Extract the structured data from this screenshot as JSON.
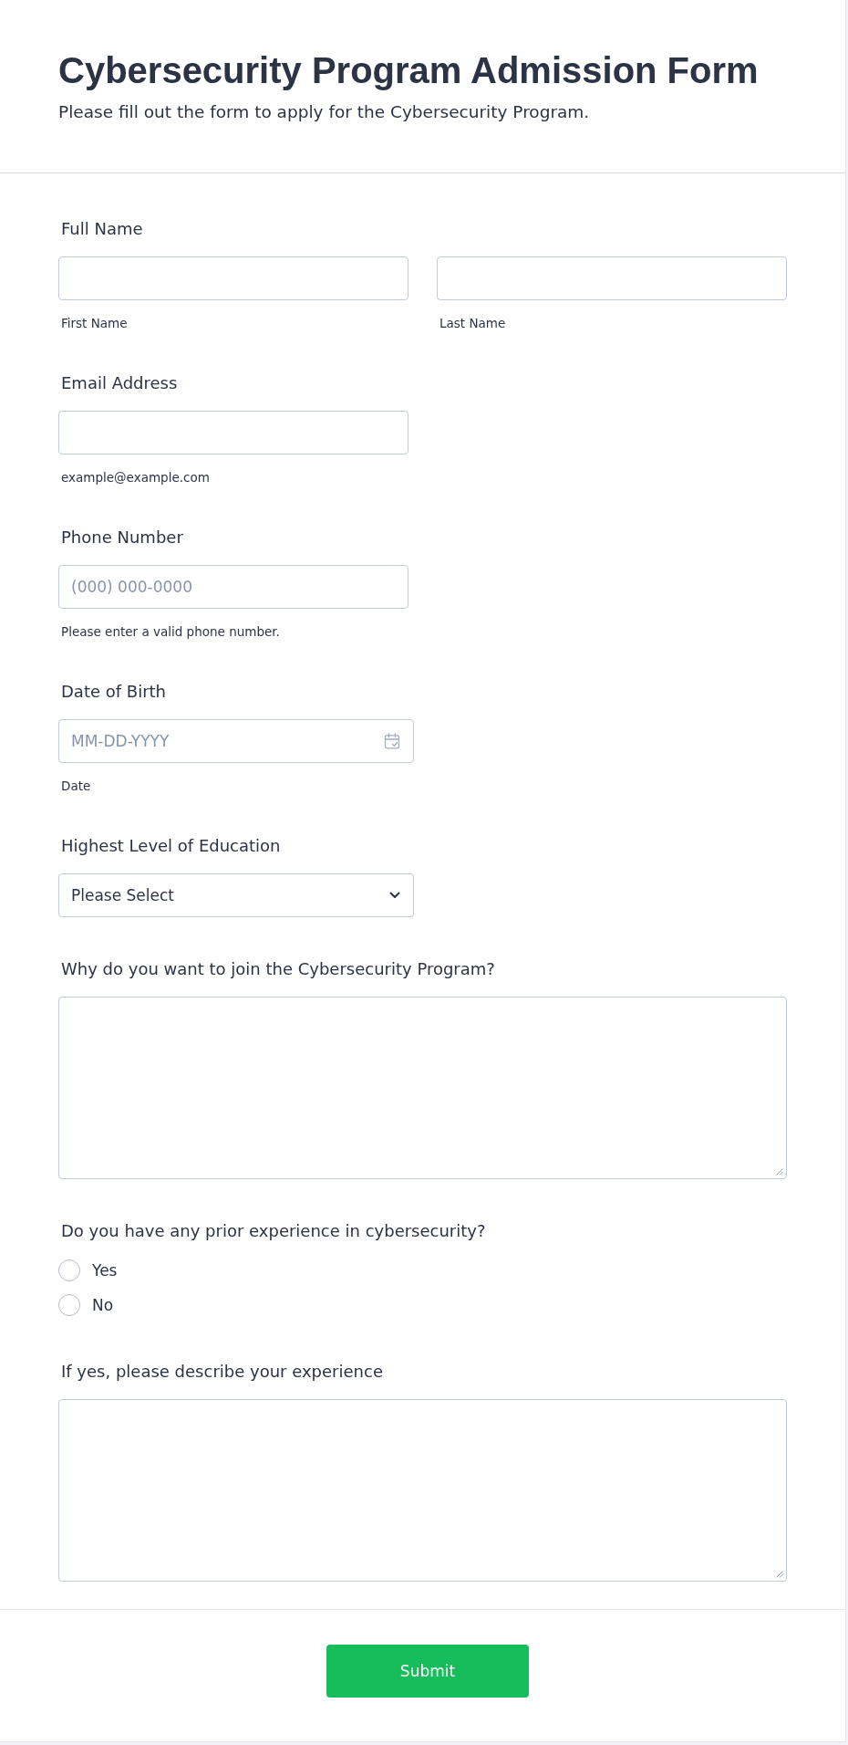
{
  "form": {
    "title": "Cybersecurity Program Admission Form",
    "description": "Please fill out the form to apply for the Cybersecurity Program."
  },
  "fields": [
    {
      "kind": "text",
      "label": "Full Name",
      "inputs": [
        {
          "sublabel": "First Name"
        },
        {
          "sublabel": "Last Name"
        }
      ]
    },
    {
      "kind": "text",
      "label": "Email Address",
      "inputs": [
        {
          "sublabel": "example@example.com"
        }
      ]
    },
    {
      "kind": "text",
      "label": "Phone Number",
      "inputs": [
        {
          "placeholder": "(000) 000-0000",
          "sublabel": "Please enter a valid phone number."
        }
      ]
    },
    {
      "kind": "date",
      "label": "Date of Birth",
      "placeholder": "MM-DD-YYYY",
      "sublabel": "Date"
    },
    {
      "kind": "select",
      "label": "Highest Level of Education",
      "value": "Please Select"
    },
    {
      "kind": "textarea",
      "label": "Why do you want to join the Cybersecurity Program?"
    },
    {
      "kind": "radio",
      "label": "Do you have any prior experience in cybersecurity?",
      "options": [
        {
          "label": "Yes",
          "selected": false
        },
        {
          "label": "No",
          "selected": false
        }
      ]
    },
    {
      "kind": "textarea",
      "label": "If yes, please describe your experience"
    }
  ],
  "submit_button": {
    "label": "Submit"
  }
}
